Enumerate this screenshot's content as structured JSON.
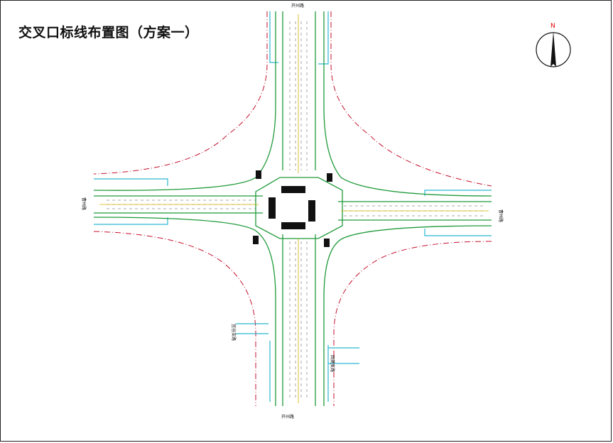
{
  "title": "交叉口标线布置图（方案一）",
  "north_arrow": {
    "label": "N"
  },
  "roads": {
    "north": "开州路",
    "south": "开州路",
    "west": "曹州路",
    "east": "曹州路",
    "branch_left": "宜谷支路",
    "branch_right": "西樊支路"
  }
}
